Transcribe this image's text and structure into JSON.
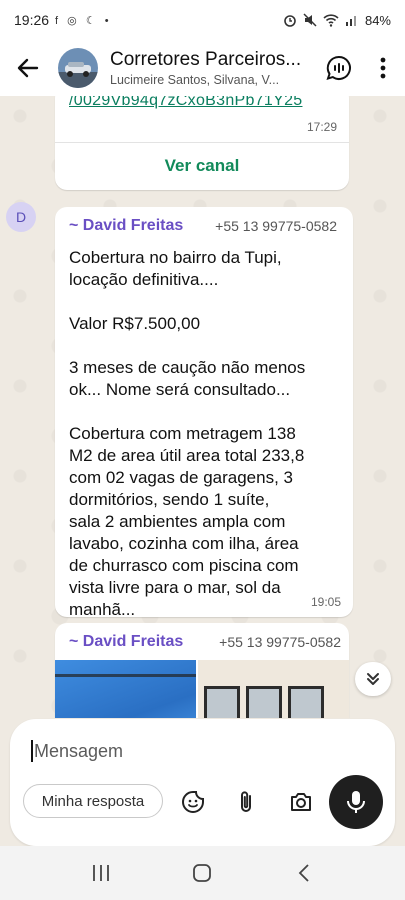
{
  "status_bar": {
    "time": "19:26",
    "indicators": "f ◎ ☾ •",
    "battery": "84%"
  },
  "header": {
    "title": "Corretores Parceiros...",
    "subtitle": "Lucimeire Santos, Silvana, V..."
  },
  "messages": [
    {
      "type": "channel_link",
      "link_text": "/0029Vb94q7zCxoB3nPb71Y25",
      "time": "17:29",
      "action_label": "Ver canal"
    },
    {
      "type": "text",
      "avatar_letter": "D",
      "sender": "~ David Freitas",
      "phone": "+55 13 99775-0582",
      "lines": [
        "Cobertura no bairro da Tupi,",
        "locação definitiva....",
        "",
        "Valor R$7.500,00",
        "",
        "3 meses de caução não menos",
        "ok... Nome será consultado...",
        "",
        "Cobertura com metragem 138",
        "M2 de area útil area total 233,8",
        "com 02 vagas de garagens,  3",
        "dormitórios, sendo 1 suíte,",
        "sala 2 ambientes ampla com",
        "lavabo, cozinha com ilha, área",
        "de churrasco com piscina com",
        "vista livre para o mar, sol da",
        "manhã..."
      ],
      "time": "19:05"
    },
    {
      "type": "photos",
      "sender": "~ David Freitas",
      "phone": "+55 13 99775-0582"
    }
  ],
  "composer": {
    "placeholder": "Mensagem",
    "reply_chip": "Minha resposta"
  },
  "icons": [
    "back-arrow-icon",
    "voice-chat-icon",
    "more-vert-icon",
    "chevron-down-icon",
    "sticker-icon",
    "attach-icon",
    "camera-icon",
    "mic-icon",
    "recents-icon",
    "home-icon",
    "back-nav-icon"
  ],
  "colors": {
    "chat_background": "#efeae2",
    "sender_name": "#6a4fc4",
    "link": "#0a7e5f",
    "action": "#128a5a",
    "mic_button": "#1f1f1f"
  }
}
